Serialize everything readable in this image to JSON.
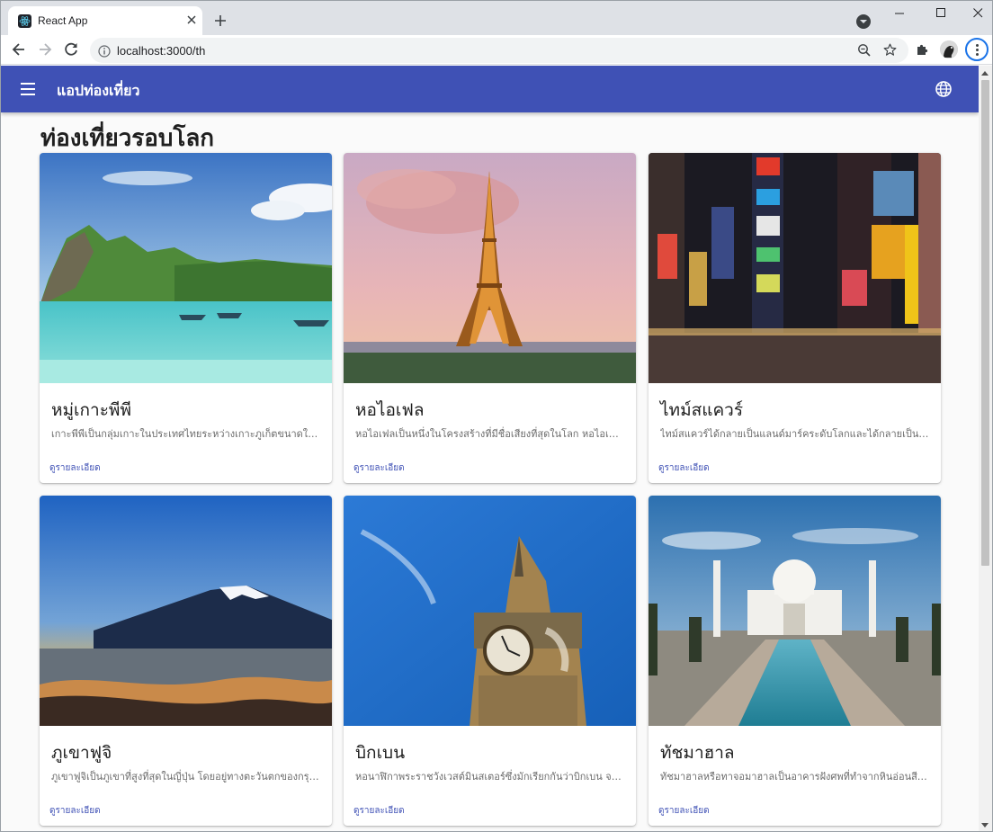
{
  "browser": {
    "tab_title": "React App",
    "url": "localhost:3000/th"
  },
  "app": {
    "title": "แอปท่องเที่ยว",
    "page_heading": "ท่องเที่ยวรอบโลก",
    "colors": {
      "appbar": "#3f51b5",
      "link": "#3f51b5"
    }
  },
  "cards": [
    {
      "title": "หมู่เกาะพีพี",
      "description": "เกาะพีพีเป็นกลุ่มเกาะในประเทศไทยระหว่างเกาะภูเก็ตขนาดใหญ่และชายฝั่งทะเลอันดามัน",
      "link": "ดูรายละเอียด",
      "image": "tropical-island-photo"
    },
    {
      "title": "หอไอเฟล",
      "description": "หอไอเฟลเป็นหนึ่งในโครงสร้างที่มีชื่อเสียงที่สุดในโลก หอไอเฟลตั้งอยู่ที่ปารีส",
      "link": "ดูรายละเอียด",
      "image": "eiffel-tower-photo"
    },
    {
      "title": "ไทม์สแควร์",
      "description": "ไทม์สแควร์ได้กลายเป็นแลนด์มาร์คระดับโลกและได้กลายเป็นสัญลักษณ์ของนิวยอร์ก",
      "link": "ดูรายละเอียด",
      "image": "times-square-photo"
    },
    {
      "title": "ภูเขาฟูจิ",
      "description": "ภูเขาฟูจิเป็นภูเขาที่สูงที่สุดในญี่ปุ่น โดยอยู่ทางตะวันตกของกรุงโตเกียว",
      "link": "ดูรายละเอียด",
      "image": "mount-fuji-photo"
    },
    {
      "title": "บิกเบน",
      "description": "หอนาฬิกาพระราชวังเวสต์มินสเตอร์ซึ่งมักเรียกกันว่าบิกเบน จริงๆ แล้วคือชื่อระฆัง",
      "link": "ดูรายละเอียด",
      "image": "big-ben-photo"
    },
    {
      "title": "ทัชมาฮาล",
      "description": "ทัชมาฮาลหรือทาจอมาฮาลเป็นอาคารฝังศพที่ทำจากหินอ่อนสีขาว",
      "link": "ดูรายละเอียด",
      "image": "taj-mahal-photo"
    }
  ]
}
